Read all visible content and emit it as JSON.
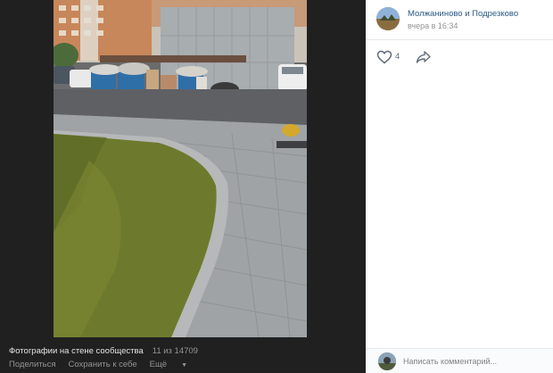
{
  "post": {
    "author": "Молжаниново и Подрезково",
    "time": "вчера в 16:34",
    "likes": "4"
  },
  "photo": {
    "album_title": "Фотографии на стене сообщества",
    "position": "11 из 14709"
  },
  "actions": {
    "share_label": "Поделиться",
    "save_label": "Сохранить к себе",
    "more_label": "Ещё"
  },
  "comment": {
    "placeholder": "Написать комментарий..."
  },
  "icons": {
    "like": "heart-icon",
    "share": "share-arrow-icon",
    "more": "chevron-down-icon"
  },
  "colors": {
    "viewer_bg": "#202020",
    "link": "#2a5885",
    "muted": "#939393"
  }
}
